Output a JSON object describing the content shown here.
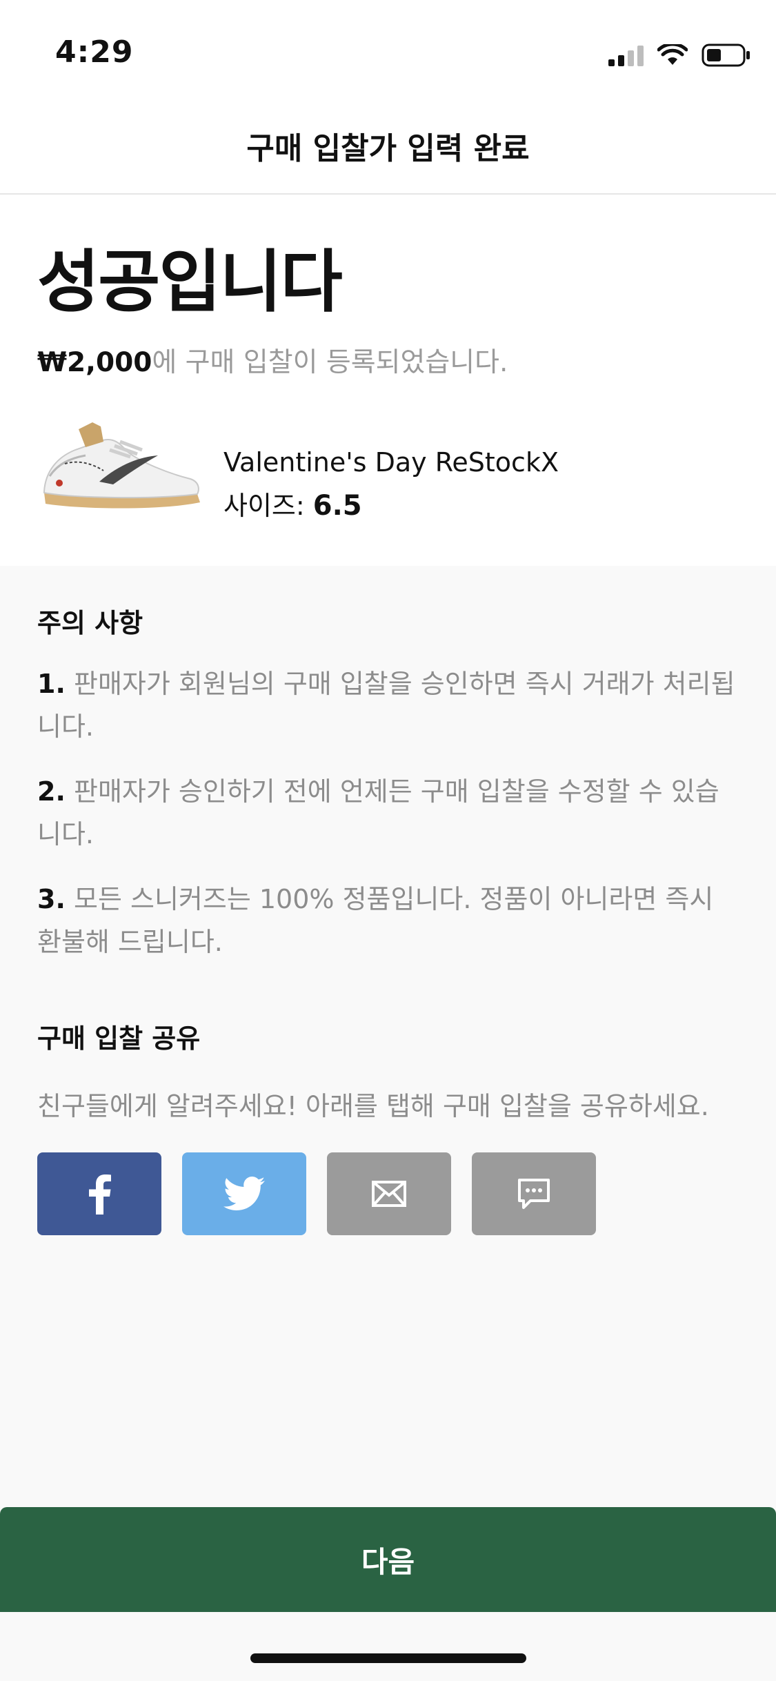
{
  "status_bar": {
    "time": "4:29",
    "icons": [
      "cellular-signal-icon",
      "wifi-icon",
      "battery-icon"
    ]
  },
  "header": {
    "title": "구매 입찰가 입력 완료"
  },
  "hero": {
    "title": "성공입니다",
    "amount": "₩2,000",
    "message_suffix": "에 구매 입찰이 등록되었습니다."
  },
  "product": {
    "name": "Valentine's Day ReStockX",
    "size_label": "사이즈:",
    "size_value": "6.5"
  },
  "notice": {
    "title": "주의 사항",
    "items": [
      {
        "num": "1.",
        "text": "판매자가 회원님의 구매 입찰을 승인하면 즉시 거래가 처리됩니다."
      },
      {
        "num": "2.",
        "text": "판매자가 승인하기 전에 언제든 구매 입찰을 수정할 수 있습니다."
      },
      {
        "num": "3.",
        "text": "모든 스니커즈는 100% 정품입니다. 정품이 아니라면 즉시 환불해 드립니다."
      }
    ]
  },
  "share": {
    "title": "구매 입찰 공유",
    "description": "친구들에게 알려주세요! 아래를 탭해 구매 입찰을 공유하세요.",
    "buttons": [
      {
        "icon": "facebook-icon",
        "color": "#3f5895"
      },
      {
        "icon": "twitter-icon",
        "color": "#6aaee8"
      },
      {
        "icon": "email-icon",
        "color": "#9b9b9b"
      },
      {
        "icon": "message-icon",
        "color": "#9b9b9b"
      }
    ]
  },
  "footer": {
    "next_label": "다음",
    "accent_color": "#2a6343"
  }
}
